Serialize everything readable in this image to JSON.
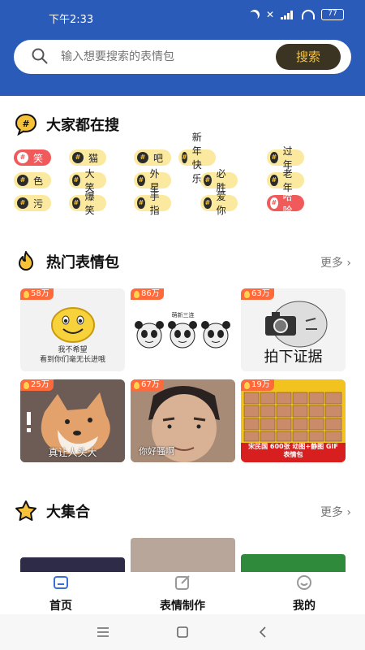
{
  "status_bar": {
    "time": "下午2:33",
    "battery": "77"
  },
  "search": {
    "placeholder": "输入想要搜索的表情包",
    "button_label": "搜索"
  },
  "hot_search": {
    "title": "大家都在搜",
    "rows": [
      [
        "笑",
        "猫",
        "吧",
        "新年快乐",
        "过年"
      ],
      [
        "色",
        "大笑",
        "外星",
        "必胜",
        "老年"
      ],
      [
        "污",
        "爆笑",
        "手指",
        "爱你",
        "哈哈"
      ]
    ],
    "highlighted": [
      "笑",
      "哈哈"
    ]
  },
  "popular": {
    "title": "热门表情包",
    "more_label": "更多",
    "cards": [
      {
        "count": "58万",
        "caption": "我不希望\n看到你们毫无长进哦"
      },
      {
        "count": "86万",
        "caption": "萌新三连"
      },
      {
        "count": "63万",
        "caption": "拍下证据"
      },
      {
        "count": "25万",
        "caption": "真让人头大"
      },
      {
        "count": "67万",
        "caption": "你好骚啊"
      },
      {
        "count": "19万",
        "caption": "宋民国 600张 动图+静图 GIF 表情包"
      }
    ]
  },
  "collection": {
    "title": "大集合",
    "more_label": "更多"
  },
  "tabbar": {
    "home": "首页",
    "make": "表情制作",
    "mine": "我的"
  },
  "colors": {
    "header": "#2b5bb8",
    "tag": "#fbe9a0",
    "tag_highlight": "#f05a5a",
    "badge": "#ff6a3c"
  }
}
